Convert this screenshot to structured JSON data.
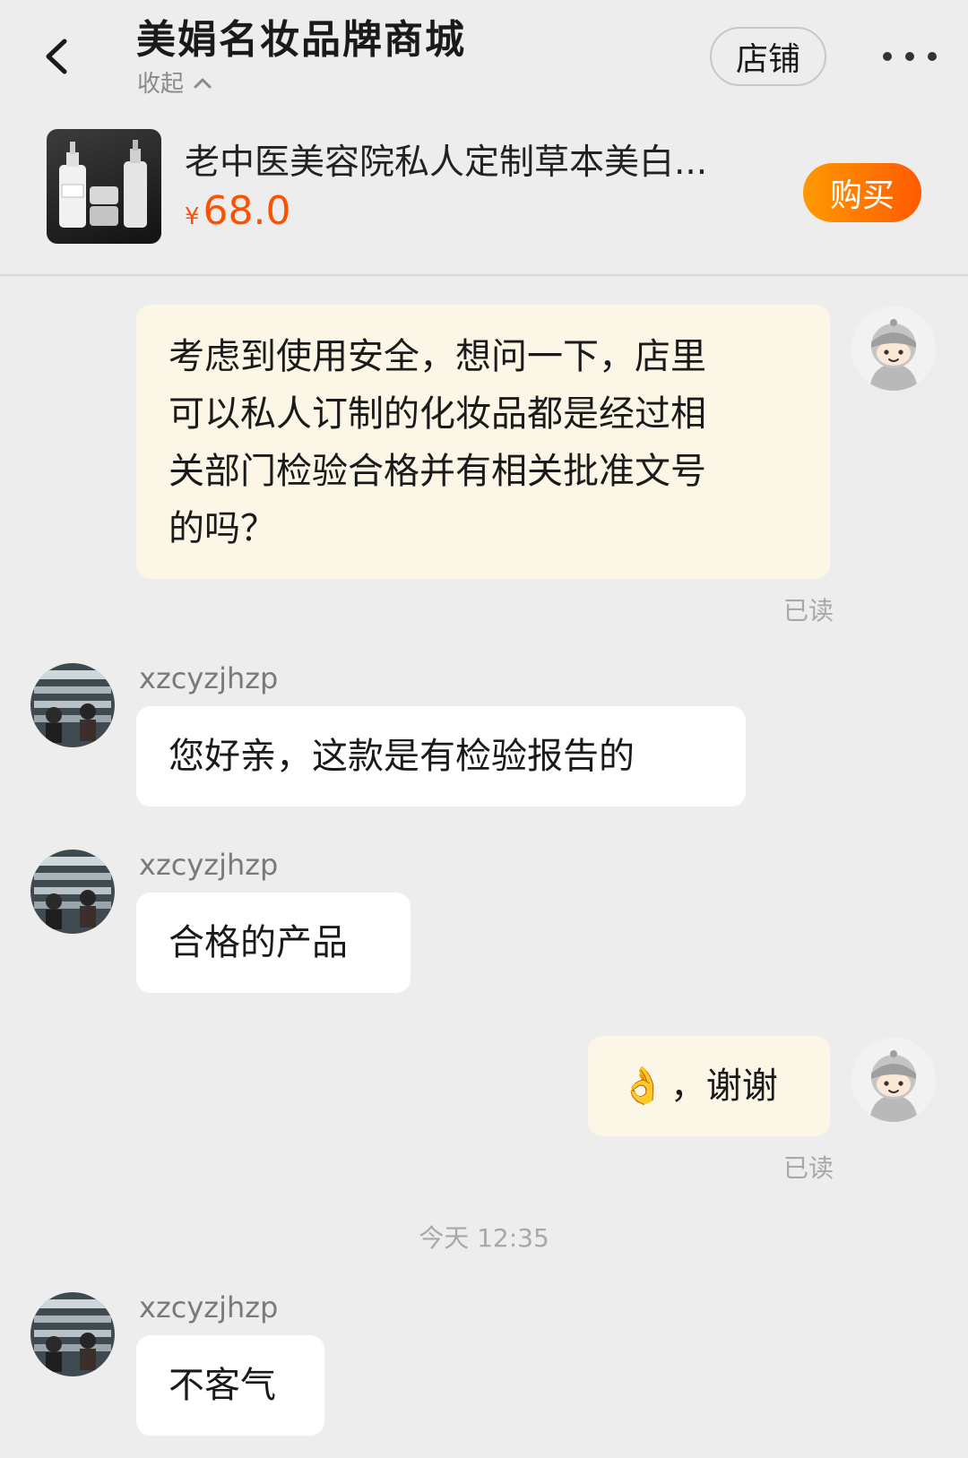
{
  "header": {
    "title": "美娟名妆品牌商城",
    "collapse_label": "收起",
    "shop_label": "店铺"
  },
  "product": {
    "name": "老中医美容院私人定制草本美白...",
    "currency": "¥",
    "price": "68.0",
    "buy_label": "购买"
  },
  "colors": {
    "accent": "#ff5000",
    "mine_bubble": "#fcf6e7",
    "theirs_bubble": "#ffffff",
    "background": "#ededed"
  },
  "messages": [
    {
      "from": "me",
      "lines": [
        "考虑到使用安全，想问一下，店里",
        "可以私人订制的化妆品都是经过相",
        "关部门检验合格并有相关批准文号",
        "的吗？"
      ],
      "status": "已读"
    },
    {
      "from": "seller",
      "sender": "xzcyzjhzp",
      "text": "您好亲，这款是有检验报告的"
    },
    {
      "from": "seller",
      "sender": "xzcyzjhzp",
      "text": "合格的产品"
    },
    {
      "from": "me",
      "emoji": "👌",
      "text": "，谢谢",
      "status": "已读"
    },
    {
      "from": "seller",
      "sender": "xzcyzjhzp",
      "text": "不客气"
    }
  ],
  "timestamp": "今天 12:35",
  "icons": {
    "back": "chevron-left-icon",
    "collapse": "chevron-up-icon",
    "more": "more-dots-icon"
  }
}
